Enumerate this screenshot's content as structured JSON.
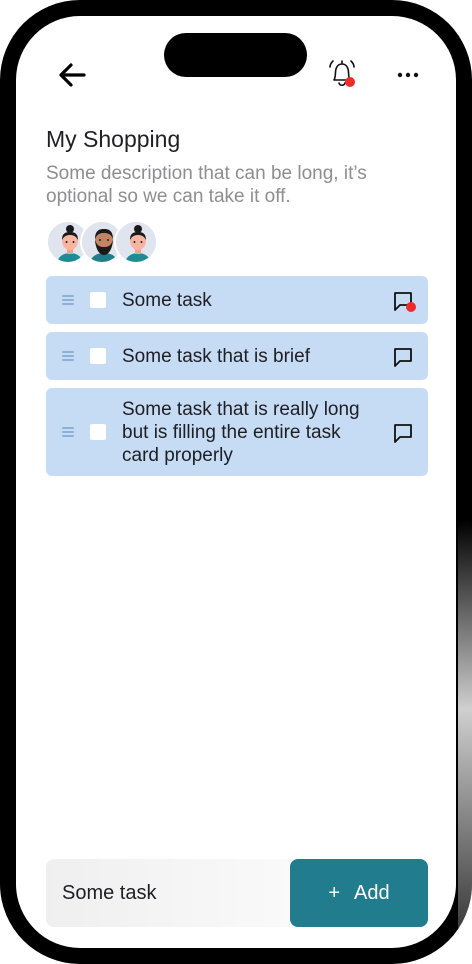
{
  "header": {
    "back_icon": "arrow-left-icon",
    "bell_icon": "bell-icon",
    "more_icon": "more-horizontal-icon",
    "notification_dot_color": "#ef2a2a"
  },
  "list": {
    "title": "My Shopping",
    "description": "Some description that can be long, it’s optional so we can take it off."
  },
  "members": [
    {
      "avatar": "woman-avatar-1"
    },
    {
      "avatar": "bearded-man-avatar"
    },
    {
      "avatar": "woman-avatar-2"
    }
  ],
  "tasks": [
    {
      "label": "Some task",
      "checked": false,
      "has_unread_comment": true
    },
    {
      "label": "Some task that is brief",
      "checked": false,
      "has_unread_comment": false
    },
    {
      "label": "Some task that is really long but is filling the entire task card properly",
      "checked": false,
      "has_unread_comment": false
    }
  ],
  "composer": {
    "input_value": "Some task",
    "add_icon": "+",
    "add_label": "Add"
  },
  "colors": {
    "task_background": "#c6dcf4",
    "accent": "#217d8e"
  }
}
